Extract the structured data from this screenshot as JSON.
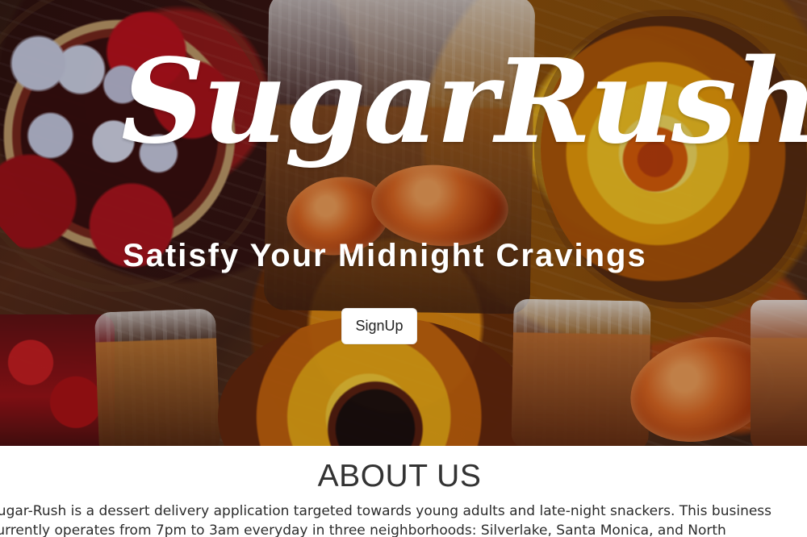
{
  "hero": {
    "brand_title": "SugarRush",
    "subtitle": "Satisfy Your Midnight Cravings",
    "signup_label": "SignUp"
  },
  "about": {
    "heading": "ABOUT US",
    "body": "Sugar-Rush is a dessert delivery application targeted towards young adults and late-night snackers. This business currently operates from 7pm to 3am everyday in three neighborhoods: Silverlake, Santa Monica, and North Hollywood."
  }
}
